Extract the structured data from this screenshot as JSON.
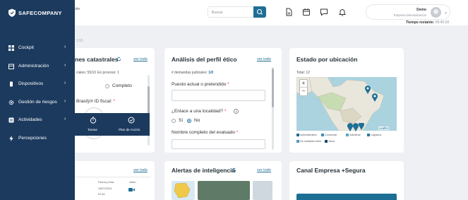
{
  "brand": {
    "name": "SAFECOMPANY"
  },
  "header": {
    "partial_tab": "ción",
    "search": {
      "placeholder": "Buscar"
    },
    "icons": [
      "document-icon",
      "calendar-icon",
      "chat-icon",
      "bell-icon"
    ],
    "user": {
      "name": "Demo",
      "company": "Empresa Demonstración"
    },
    "timer_label": "Tiempo restante:",
    "timer_value": "09:45:29"
  },
  "background_text": "1:55",
  "sidebar": {
    "items": [
      {
        "label": "Cockpit",
        "icon": "grid-icon"
      },
      {
        "label": "Administración",
        "icon": "building-icon"
      },
      {
        "label": "Dispositivos",
        "icon": "device-icon"
      },
      {
        "label": "Gestión de riesgos",
        "icon": "risk-gear-icon"
      },
      {
        "label": "Actividades",
        "icon": "activities-icon"
      },
      {
        "label": "Percepciones",
        "icon": "lightning-icon"
      }
    ],
    "arrow": "›"
  },
  "flyout": {
    "items": [
      {
        "label": "Tareas",
        "icon": "stopwatch-icon"
      },
      {
        "label": "Plan de Acción",
        "icon": "check-circle-icon"
      }
    ]
  },
  "cards": {
    "catastrales": {
      "title": "nes catastrales",
      "link": "ver todo",
      "status": "ciales: 55/10",
      "status2": "En proceso: 1",
      "option": "Completo",
      "field_label": "Brasil)/# ID fiscal:",
      "required": "*"
    },
    "perfil": {
      "title": "Análisis del perfil ético",
      "link": "ver todo",
      "demandas_label": "# demandas judiciales:",
      "demandas_value": "1/0",
      "field1_label": "Puesto actual o pretendido",
      "field2_label": "¿Enlace a una localidad?",
      "yes": "Sí",
      "no": "No",
      "field3_label": "Nombre completo del evaluado",
      "required": "*"
    },
    "estado": {
      "title": "Estado por ubicación",
      "total": "Total: 12",
      "zoom_in": "+",
      "zoom_out": "−",
      "attribution": "Leaflet",
      "legend": [
        {
          "label": "Administrativo",
          "color": "#1e6f95"
        },
        {
          "label": "Comercial",
          "color": "#3d8fb8"
        },
        {
          "label": "Industrial",
          "color": "#5aa7c9"
        },
        {
          "label": "Logística",
          "color": "#2b7da3"
        },
        {
          "label": "De múltiples fines",
          "color": "#4a9ac0"
        },
        {
          "label": "Otros",
          "color": "#164e6d"
        }
      ]
    },
    "tabla": {
      "link": "ver todo",
      "col1": "Fecha y hora",
      "col2": "Video",
      "date": "13/07/2024",
      "time": "07:44"
    },
    "alertas": {
      "title": "Alertas de inteligencia",
      "link": "ver todo"
    },
    "canal": {
      "title": "Canal Empresa +Segura"
    }
  },
  "colors": {
    "sidebar": "#1c3a5e",
    "accent": "#1e6f95",
    "background": "#eef0f3"
  }
}
